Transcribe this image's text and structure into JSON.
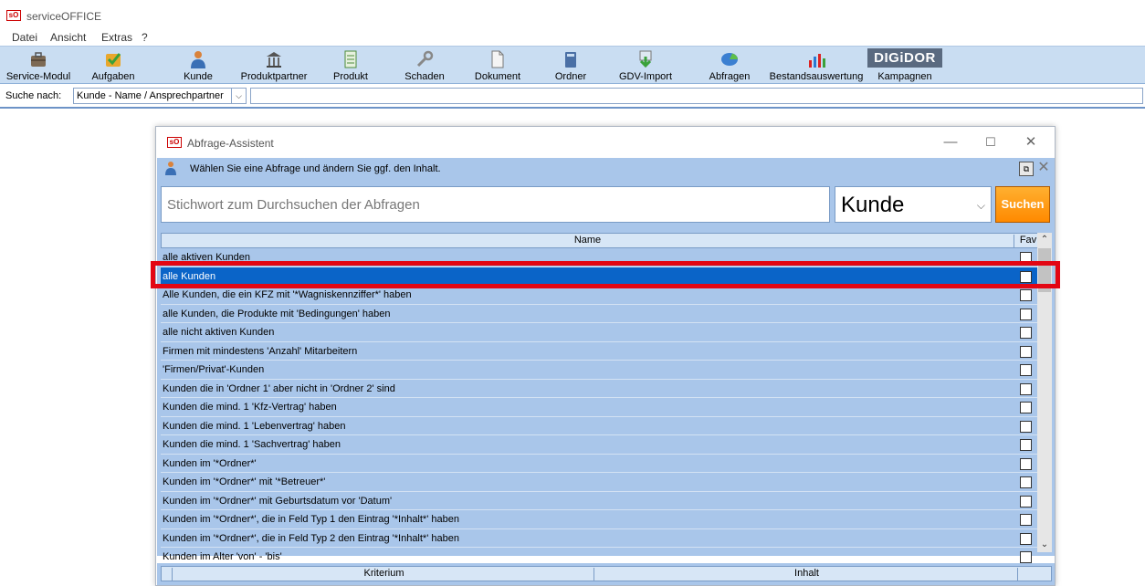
{
  "app": {
    "logo": "sO",
    "title": "serviceOFFICE"
  },
  "menu": [
    "Datei",
    "Ansicht",
    "Extras",
    "?"
  ],
  "toolbar": [
    {
      "label": "Service-Modul",
      "icon": "briefcase-icon"
    },
    {
      "label": "Aufgaben",
      "icon": "task-check-icon"
    },
    {
      "label": "Kunde",
      "icon": "customer-icon"
    },
    {
      "label": "Produktpartner",
      "icon": "institution-icon"
    },
    {
      "label": "Produkt",
      "icon": "product-sheet-icon"
    },
    {
      "label": "Schaden",
      "icon": "wrench-icon"
    },
    {
      "label": "Dokument",
      "icon": "document-icon"
    },
    {
      "label": "Ordner",
      "icon": "folder-icon"
    },
    {
      "label": "GDV-Import",
      "icon": "gdv-import-icon"
    },
    {
      "label": "Abfragen",
      "icon": "pie-chart-icon"
    },
    {
      "label": "Bestandsauswertung",
      "icon": "bar-chart-icon"
    },
    {
      "label": "Kampagnen",
      "icon": "digidor-logo",
      "badge": "DIGiDOR"
    }
  ],
  "search": {
    "label": "Suche nach:",
    "selected": "Kunde - Name / Ansprechpartner"
  },
  "dialog": {
    "logo": "sO",
    "title": "Abfrage-Assistent",
    "controls": {
      "minimize": "—",
      "maximize": "☐",
      "close": "✕"
    },
    "hint": "Wählen Sie eine Abfrage und ändern Sie ggf. den Inhalt.",
    "keyword_placeholder": "Stichwort zum Durchsuchen der Abfragen",
    "category": "Kunde",
    "search_button": "Suchen",
    "columns": {
      "name": "Name",
      "fav": "Fav"
    },
    "rows": [
      {
        "name": "alle aktiven Kunden",
        "selected": false
      },
      {
        "name": "alle Kunden",
        "selected": true
      },
      {
        "name": "Alle Kunden, die ein KFZ mit '*Wagniskennziffer*' haben",
        "selected": false
      },
      {
        "name": "alle Kunden, die Produkte mit 'Bedingungen' haben",
        "selected": false
      },
      {
        "name": "alle nicht aktiven Kunden",
        "selected": false
      },
      {
        "name": "Firmen mit mindestens 'Anzahl' Mitarbeitern",
        "selected": false
      },
      {
        "name": "'Firmen/Privat'-Kunden",
        "selected": false
      },
      {
        "name": "Kunden die in 'Ordner 1' aber nicht in 'Ordner 2' sind",
        "selected": false
      },
      {
        "name": "Kunden die mind. 1 'Kfz-Vertrag' haben",
        "selected": false
      },
      {
        "name": "Kunden die mind. 1 'Lebenvertrag' haben",
        "selected": false
      },
      {
        "name": "Kunden die mind. 1 'Sachvertrag' haben",
        "selected": false
      },
      {
        "name": "Kunden im '*Ordner*'",
        "selected": false
      },
      {
        "name": "Kunden im '*Ordner*' mit '*Betreuer*'",
        "selected": false
      },
      {
        "name": "Kunden im '*Ordner*' mit Geburtsdatum vor 'Datum'",
        "selected": false
      },
      {
        "name": "Kunden im '*Ordner*', die in Feld Typ 1 den Eintrag '*Inhalt*' haben",
        "selected": false
      },
      {
        "name": "Kunden im '*Ordner*', die in Feld Typ 2 den Eintrag '*Inhalt*' haben",
        "selected": false
      },
      {
        "name": "Kunden im Alter 'von' - 'bis'",
        "selected": false
      }
    ],
    "criteria_columns": {
      "kriterium": "Kriterium",
      "inhalt": "Inhalt"
    }
  },
  "colors": {
    "selection": "#0a64c8",
    "panel": "#a9c6ea",
    "toolbar": "#c9ddf2",
    "search_button": "#ff8a00",
    "highlight": "#e30613"
  }
}
